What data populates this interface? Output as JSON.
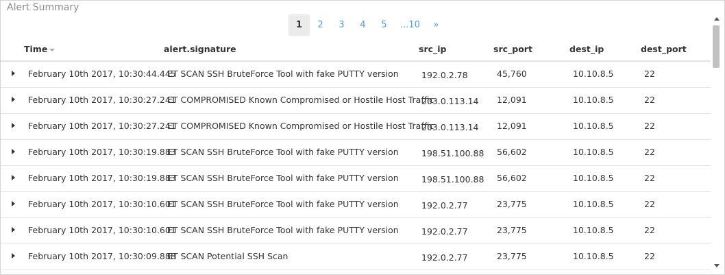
{
  "panel": {
    "title": "Alert Summary"
  },
  "pagination": {
    "pages": [
      "1",
      "2",
      "3",
      "4",
      "5",
      "...10"
    ],
    "next": "»",
    "current": "1"
  },
  "columns": {
    "time": "Time",
    "signature": "alert.signature",
    "src_ip": "src_ip",
    "src_port": "src_port",
    "dest_ip": "dest_ip",
    "dest_port": "dest_port"
  },
  "rows": [
    {
      "time": "February 10th 2017, 10:30:44.445",
      "signature": "ET SCAN SSH BruteForce Tool with fake PUTTY version",
      "src_ip": "192.0.2.78",
      "src_port": "45,760",
      "dest_ip": "10.10.8.5",
      "dest_port": "22"
    },
    {
      "time": "February 10th 2017, 10:30:27.241",
      "signature": "ET COMPROMISED Known Compromised or Hostile Host Traffic",
      "src_ip": "203.0.113.14",
      "src_port": "12,091",
      "dest_ip": "10.10.8.5",
      "dest_port": "22"
    },
    {
      "time": "February 10th 2017, 10:30:27.241",
      "signature": "ET COMPROMISED Known Compromised or Hostile Host Traffic",
      "src_ip": "203.0.113.14",
      "src_port": "12,091",
      "dest_ip": "10.10.8.5",
      "dest_port": "22"
    },
    {
      "time": "February 10th 2017, 10:30:19.883",
      "signature": "ET SCAN SSH BruteForce Tool with fake PUTTY version",
      "src_ip": "198.51.100.88",
      "src_port": "56,602",
      "dest_ip": "10.10.8.5",
      "dest_port": "22"
    },
    {
      "time": "February 10th 2017, 10:30:19.883",
      "signature": "ET SCAN SSH BruteForce Tool with fake PUTTY version",
      "src_ip": "198.51.100.88",
      "src_port": "56,602",
      "dest_ip": "10.10.8.5",
      "dest_port": "22"
    },
    {
      "time": "February 10th 2017, 10:30:10.601",
      "signature": "ET SCAN SSH BruteForce Tool with fake PUTTY version",
      "src_ip": "192.0.2.77",
      "src_port": "23,775",
      "dest_ip": "10.10.8.5",
      "dest_port": "22"
    },
    {
      "time": "February 10th 2017, 10:30:10.601",
      "signature": "ET SCAN SSH BruteForce Tool with fake PUTTY version",
      "src_ip": "192.0.2.77",
      "src_port": "23,775",
      "dest_ip": "10.10.8.5",
      "dest_port": "22"
    },
    {
      "time": "February 10th 2017, 10:30:09.888",
      "signature": "ET SCAN Potential SSH Scan",
      "src_ip": "192.0.2.77",
      "src_port": "23,775",
      "dest_ip": "10.10.8.5",
      "dest_port": "22"
    }
  ],
  "icons": {
    "expand": "caret-right-icon",
    "sort": "sort-down-icon",
    "scroll_up": "arrow-up-icon",
    "scroll_down": "arrow-down-icon"
  },
  "colors": {
    "link": "#4da1d8",
    "active_page_bg": "#ebebeb",
    "title": "#8c8c8c"
  }
}
